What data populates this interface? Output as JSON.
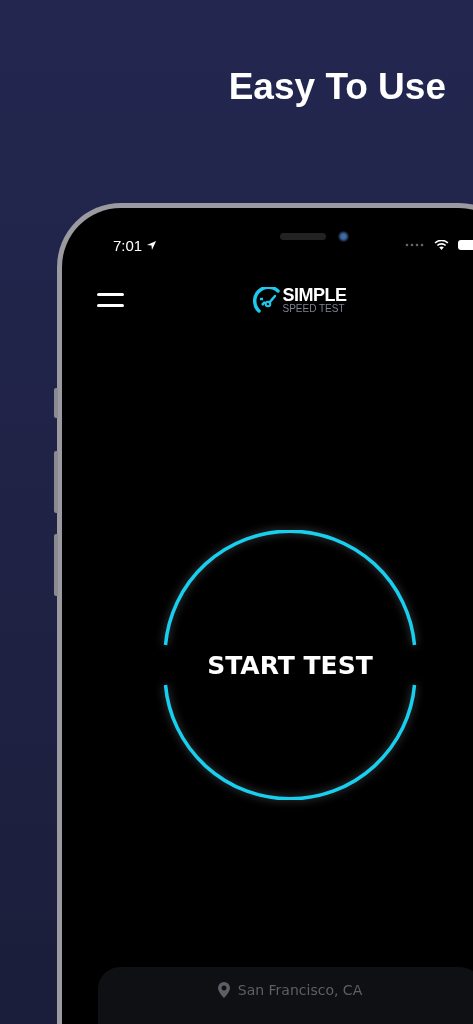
{
  "headline": "Easy To Use",
  "status_bar": {
    "time": "7:01"
  },
  "logo": {
    "title": "SIMPLE",
    "subtitle": "SPEED TEST"
  },
  "start_button": {
    "label": "START TEST"
  },
  "location": {
    "text": "San Francisco, CA"
  }
}
